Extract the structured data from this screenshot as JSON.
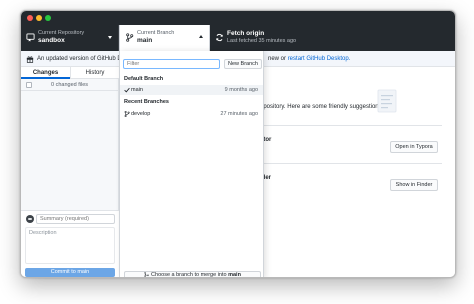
{
  "toolbar": {
    "repo": {
      "small": "Current Repository",
      "big": "sandbox"
    },
    "branch": {
      "small": "Current Branch",
      "big": "main"
    },
    "fetch": {
      "small": "Fetch origin",
      "big": "Last fetched 35 minutes ago"
    }
  },
  "banner": {
    "text": "An updated version of GitHub Deskto",
    "tail_plain": "new or ",
    "tail_link": "restart GitHub Desktop."
  },
  "sidebar": {
    "tabs": [
      {
        "label": "Changes"
      },
      {
        "label": "History"
      }
    ],
    "changed_files": "0 changed files",
    "commit": {
      "summary_placeholder": "Summary (required)",
      "description_placeholder": "Description",
      "button": "Commit to main"
    }
  },
  "main": {
    "text": "repository. Here are some friendly suggestions",
    "cards": [
      {
        "label": "ditor",
        "button": "Open in Typora"
      },
      {
        "label": "nder",
        "button": "Show in Finder"
      }
    ]
  },
  "dropdown": {
    "filter_placeholder": "Filter",
    "new_branch": "New Branch",
    "default_header": "Default Branch",
    "recent_header": "Recent Branches",
    "branches": [
      {
        "name": "main",
        "time": "9 months ago"
      },
      {
        "name": "develop",
        "time": "27 minutes ago"
      }
    ],
    "merge_prefix": "Choose a branch to merge into ",
    "merge_target": "main"
  },
  "colors": {
    "toolbar_bg": "#24292e",
    "accent": "#0366d6",
    "commit_button": "#6ca6e6"
  }
}
